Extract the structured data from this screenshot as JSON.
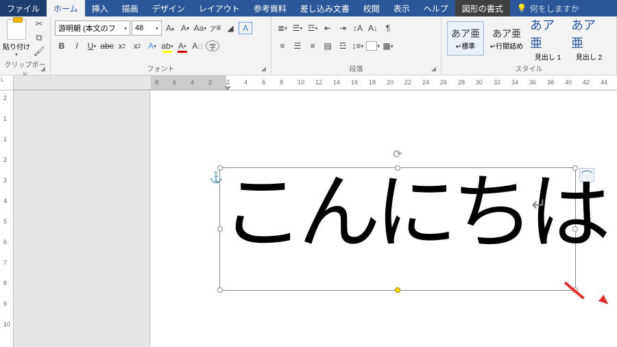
{
  "menu": {
    "file": "ファイル",
    "home": "ホーム",
    "insert": "挿入",
    "draw": "描画",
    "design": "デザイン",
    "layout": "レイアウト",
    "reference": "参考資料",
    "mailings": "差し込み文書",
    "review": "校閲",
    "view": "表示",
    "help": "ヘルプ",
    "format": "図形の書式",
    "search": "何をしますか"
  },
  "ribbon": {
    "clipboard": {
      "paste": "貼り付け",
      "label": "クリップボード"
    },
    "font": {
      "name": "游明朝 (本文のフ",
      "size": "48",
      "label": "フォント"
    },
    "paragraph": {
      "label": "段落"
    },
    "styles": {
      "label": "スタイル",
      "preview": "あア亜",
      "items": [
        {
          "name": "標準"
        },
        {
          "name": "行間詰め"
        },
        {
          "name": "見出し 1"
        },
        {
          "name": "見出し 2"
        }
      ]
    }
  },
  "ruler": {
    "hticks": [
      8,
      6,
      4,
      2,
      2,
      4,
      6,
      8,
      10,
      12,
      14,
      16,
      18,
      20,
      22,
      24,
      26,
      28,
      30,
      32,
      34,
      36,
      38,
      40,
      42,
      44
    ],
    "vticks": [
      2,
      1,
      1,
      2,
      3,
      4,
      5,
      6,
      7,
      8,
      9,
      10
    ]
  },
  "document": {
    "text": "こんにちは"
  }
}
